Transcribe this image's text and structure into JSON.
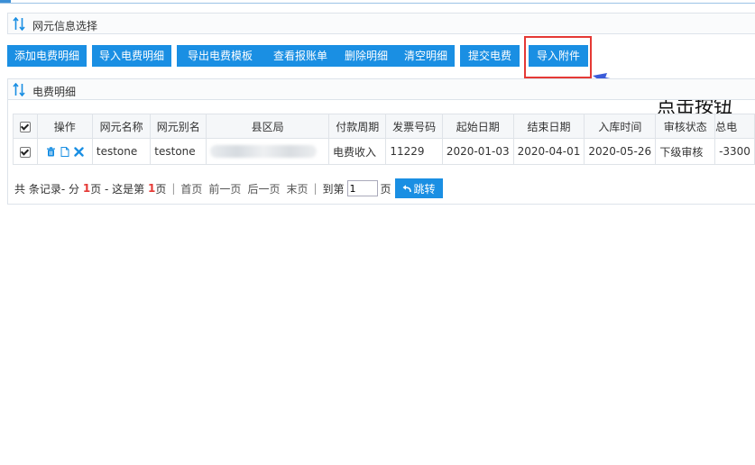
{
  "top_panel": {
    "title": "网元信息选择"
  },
  "toolbar": {
    "buttons": [
      {
        "label": "添加电费明细"
      },
      {
        "label": "导入电费明细"
      },
      {
        "label": "导出电费模板"
      },
      {
        "label": "查看报账单"
      },
      {
        "label": "删除明细"
      },
      {
        "label": "清空明细"
      },
      {
        "label": "提交电费"
      },
      {
        "label": "导入附件"
      }
    ]
  },
  "annotation": {
    "text": "点击按钮",
    "highlight_color": "#e53935",
    "arrow_color": "#3a5bd9"
  },
  "detail_panel": {
    "title": "电费明细"
  },
  "table": {
    "columns": [
      "操作",
      "网元名称",
      "网元别名",
      "县区局",
      "付款周期",
      "发票号码",
      "起始日期",
      "结束日期",
      "入库时间",
      "审核状态",
      "总电"
    ],
    "rows": [
      {
        "name": "testone",
        "alias": "testone",
        "county": "",
        "payment_cycle": "电费收入",
        "invoice_no": "11229",
        "start_date": "2020-01-03",
        "end_date": "2020-04-01",
        "stock_time": "2020-05-26",
        "status": "下级审核",
        "total": "-3300"
      }
    ]
  },
  "pager": {
    "total_prefix": "共",
    "total_suffix": "条记录- 分",
    "pages": "1",
    "pages_suffix": "页 - 这是第",
    "current": "1",
    "current_suffix": "页",
    "first": "首页",
    "prev": "前一页",
    "next": "后一页",
    "last": "末页",
    "goto_prefix": "到第",
    "goto_value": "1",
    "goto_suffix": "页",
    "jump_label": "跳转"
  },
  "colors": {
    "primary": "#1a8fe3",
    "status_pending": "#e6a817"
  }
}
